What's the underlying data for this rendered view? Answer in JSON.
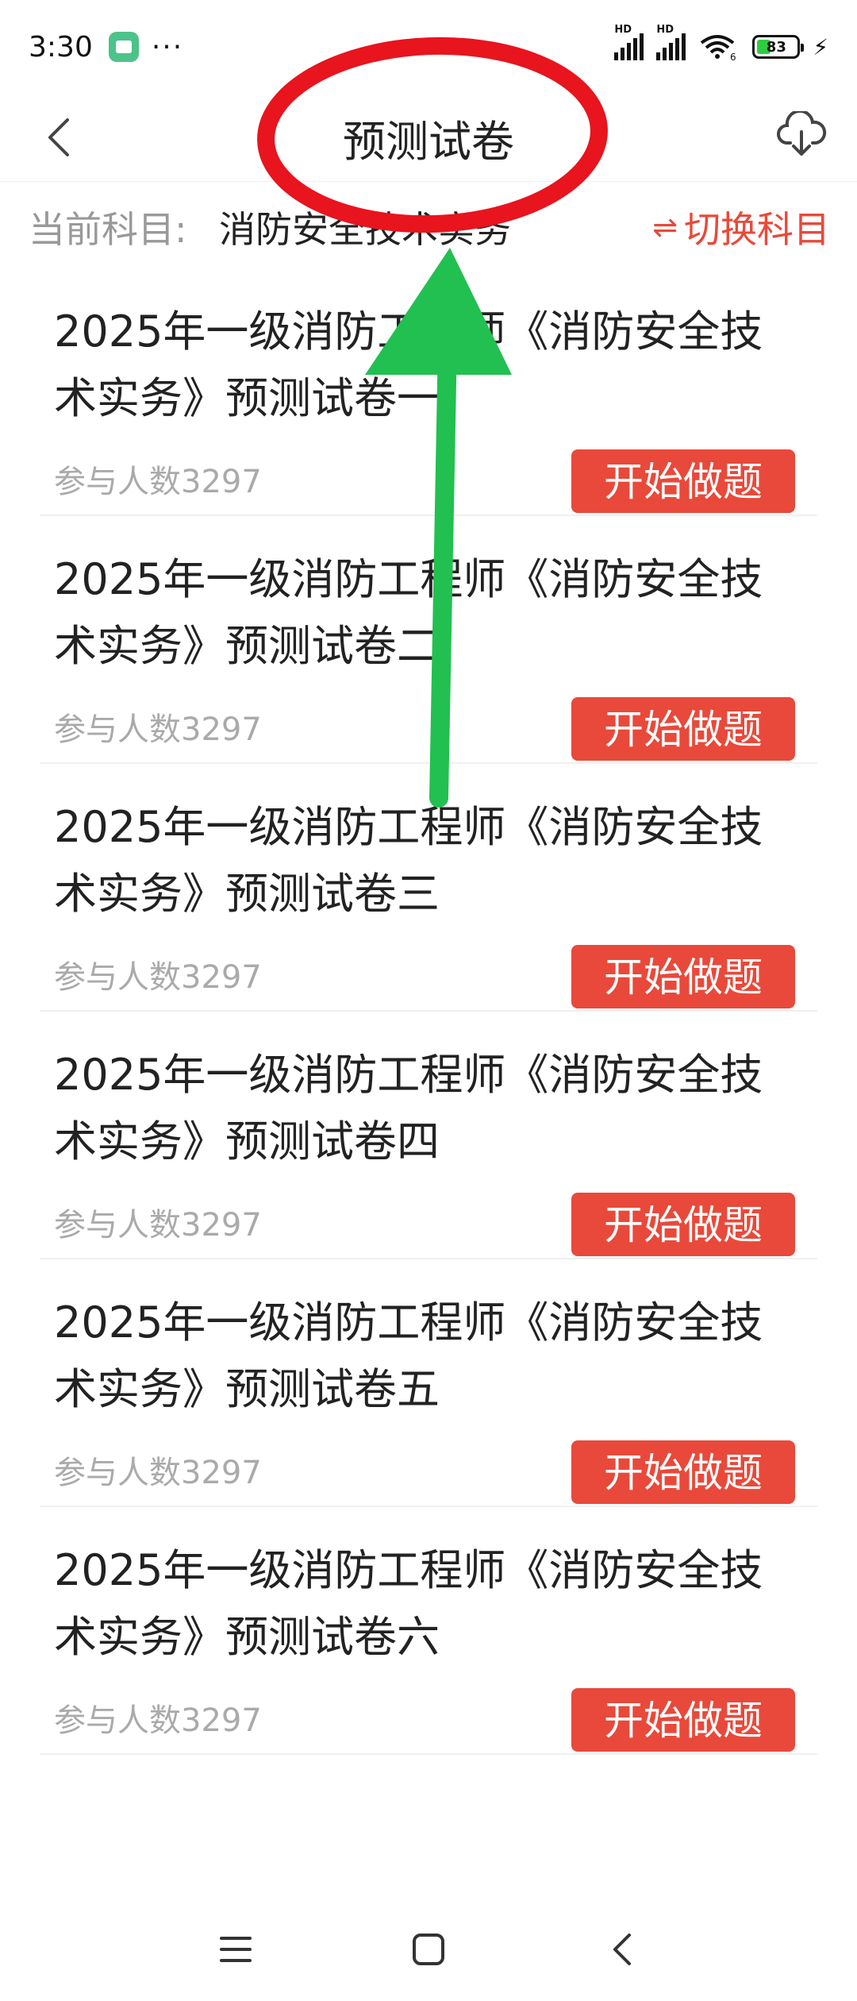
{
  "status_bar": {
    "time": "3:30",
    "dots": "···",
    "battery_level": "83",
    "signal_1_label": "HD",
    "signal_2_label": "HD",
    "wifi_label": "6"
  },
  "nav": {
    "title": "预测试卷"
  },
  "subject": {
    "label": "当前科目:",
    "value": "消防安全技术实务",
    "switch_label": "切换科目",
    "switch_icon": "⇌"
  },
  "papers": [
    {
      "title": "2025年一级消防工程师《消防安全技术实务》预测试卷一",
      "count": "参与人数3297",
      "button": "开始做题"
    },
    {
      "title": "2025年一级消防工程师《消防安全技术实务》预测试卷二",
      "count": "参与人数3297",
      "button": "开始做题"
    },
    {
      "title": "2025年一级消防工程师《消防安全技术实务》预测试卷三",
      "count": "参与人数3297",
      "button": "开始做题"
    },
    {
      "title": "2025年一级消防工程师《消防安全技术实务》预测试卷四",
      "count": "参与人数3297",
      "button": "开始做题"
    },
    {
      "title": "2025年一级消防工程师《消防安全技术实务》预测试卷五",
      "count": "参与人数3297",
      "button": "开始做题"
    },
    {
      "title": "2025年一级消防工程师《消防安全技术实务》预测试卷六",
      "count": "参与人数3297",
      "button": "开始做题"
    }
  ],
  "colors": {
    "accent": "#e8493a",
    "annotation_circle": "#e8141e",
    "annotation_arrow": "#22c050"
  },
  "icons": {
    "back": "chevron-left-icon",
    "download": "cloud-download-icon",
    "switch": "swap-icon",
    "menu": "menu-icon",
    "home": "home-square-icon",
    "nav_back": "nav-back-icon"
  }
}
